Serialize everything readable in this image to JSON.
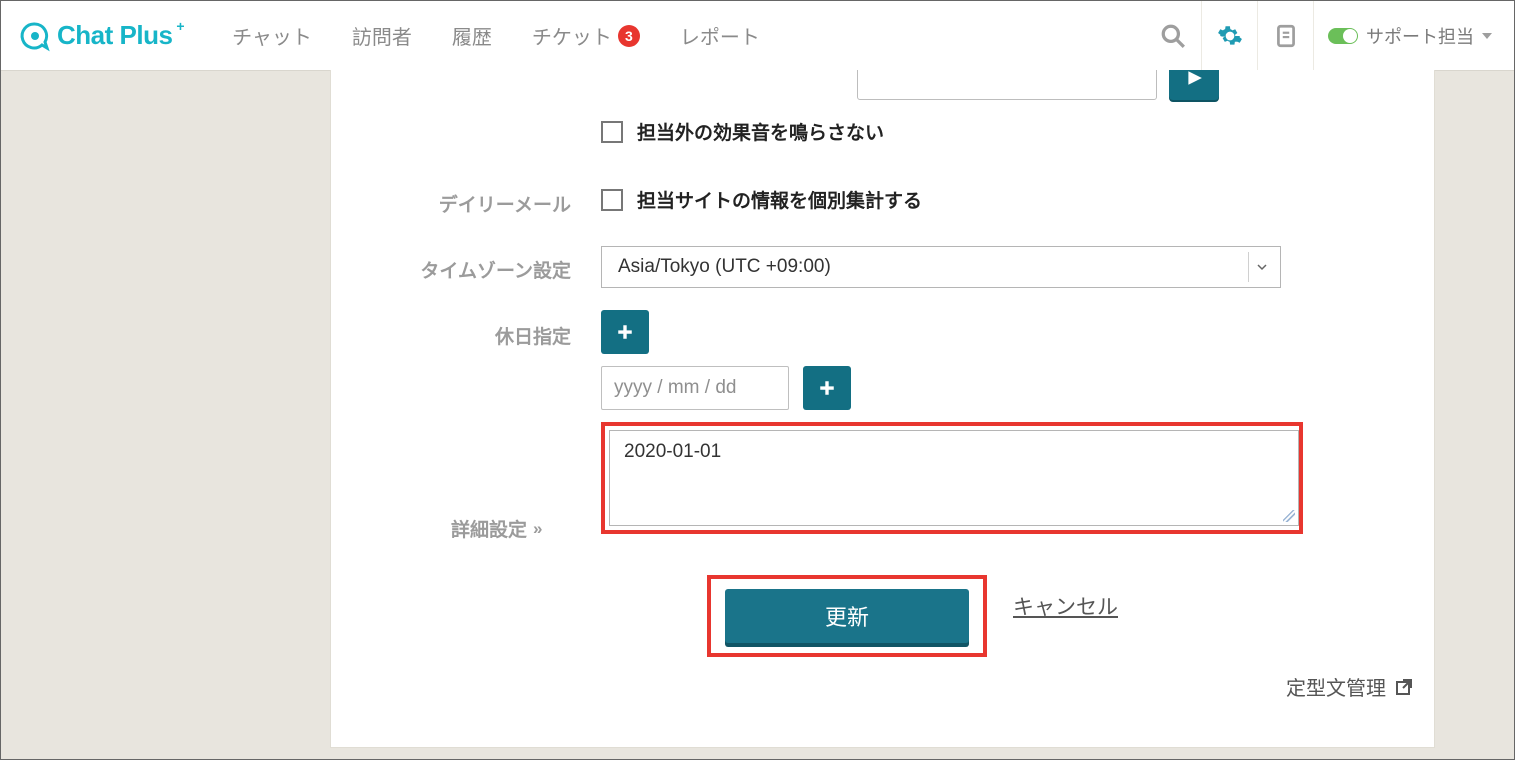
{
  "logo_text": "Chat Plus",
  "nav": {
    "chat": "チャット",
    "visitors": "訪問者",
    "history": "履歴",
    "ticket": "チケット",
    "ticket_badge": "3",
    "report": "レポート"
  },
  "header": {
    "support_label": "サポート担当"
  },
  "form": {
    "sound_checkbox_label": "担当外の効果音を鳴らさない",
    "daily_mail_label": "デイリーメール",
    "daily_mail_checkbox_label": "担当サイトの情報を個別集計する",
    "timezone_label": "タイムゾーン設定",
    "timezone_value": "Asia/Tokyo (UTC +09:00)",
    "holiday_label": "休日指定",
    "holiday_date_placeholder": "yyyy / mm / dd",
    "holiday_list_value": "2020-01-01",
    "advanced_label": "詳細設定",
    "submit_label": "更新",
    "cancel_label": "キャンセル",
    "footer_link_label": "定型文管理"
  },
  "colors": {
    "brand": "#17b5c8",
    "primary_button": "#1a748a",
    "highlight_border": "#e8362f"
  }
}
